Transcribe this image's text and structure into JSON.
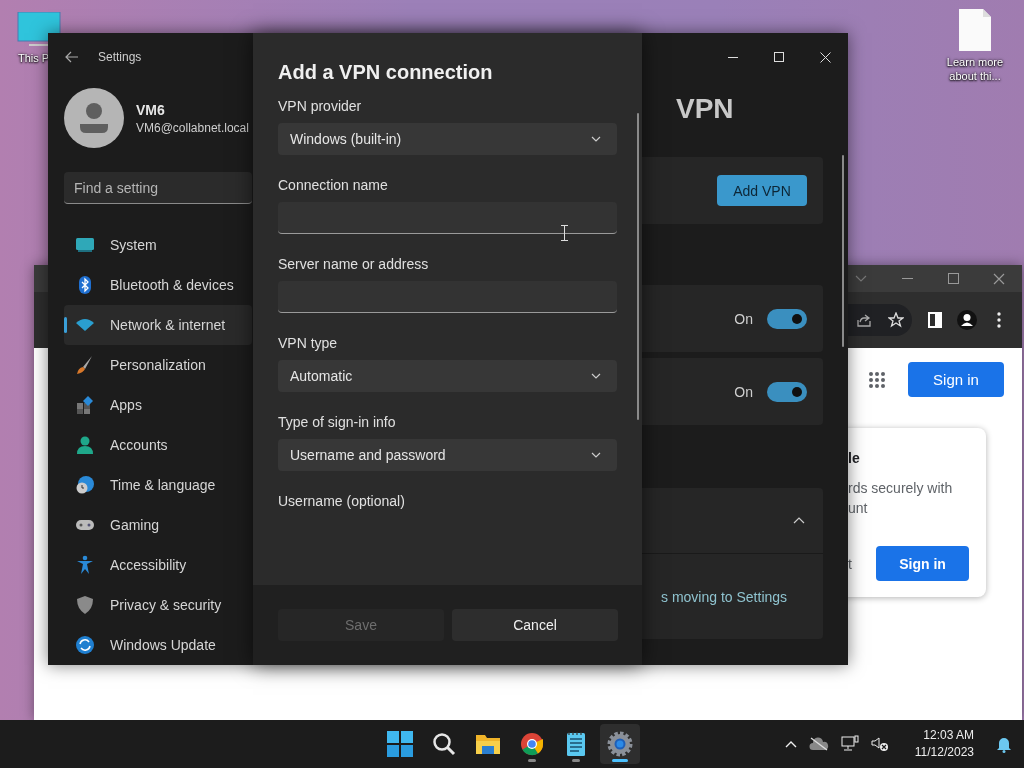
{
  "desktop_icons": [
    {
      "kind": "monitor",
      "label": "This P"
    },
    {
      "kind": "document",
      "label": "Learn more about thi..."
    }
  ],
  "browser": {
    "buttons": [
      "Sign in"
    ],
    "card": {
      "heading": "le",
      "lines": [
        "rds securely with",
        "unt"
      ],
      "footer_text": "t",
      "button": "Sign in"
    }
  },
  "settings": {
    "title": "Settings",
    "user": {
      "name": "VM6",
      "email": "VM6@collabnet.local"
    },
    "search": {
      "placeholder": "Find a setting"
    },
    "nav": [
      {
        "kind": "system",
        "label": "System",
        "selected": false
      },
      {
        "kind": "bluetooth",
        "label": "Bluetooth & devices",
        "selected": false
      },
      {
        "kind": "network",
        "label": "Network & internet",
        "selected": true
      },
      {
        "kind": "brush",
        "label": "Personalization",
        "selected": false
      },
      {
        "kind": "apps",
        "label": "Apps",
        "selected": false
      },
      {
        "kind": "accounts",
        "label": "Accounts",
        "selected": false
      },
      {
        "kind": "time",
        "label": "Time & language",
        "selected": false
      },
      {
        "kind": "gaming",
        "label": "Gaming",
        "selected": false
      },
      {
        "kind": "accessibility",
        "label": "Accessibility",
        "selected": false
      },
      {
        "kind": "privacy",
        "label": "Privacy & security",
        "selected": false
      },
      {
        "kind": "update",
        "label": "Windows Update",
        "selected": false
      }
    ],
    "page": {
      "title": "VPN",
      "add_button": "Add VPN",
      "toggles": [
        {
          "label": "On",
          "on": true
        },
        {
          "label": "On",
          "on": true
        }
      ],
      "expander": {
        "expanded": true,
        "link": "s moving to Settings"
      }
    }
  },
  "dialog": {
    "title": "Add a VPN connection",
    "fields": [
      {
        "kind": "dropdown",
        "label": "VPN provider",
        "value": "Windows (built-in)"
      },
      {
        "kind": "text",
        "label": "Connection name"
      },
      {
        "kind": "text",
        "label": "Server name or address"
      },
      {
        "kind": "dropdown",
        "label": "VPN type",
        "value": "Automatic"
      },
      {
        "kind": "dropdown",
        "label": "Type of sign-in info",
        "value": "Username and password"
      },
      {
        "kind": "label",
        "label": "Username (optional)"
      }
    ],
    "buttons": [
      {
        "label": "Save",
        "disabled": true
      },
      {
        "label": "Cancel",
        "disabled": false
      }
    ]
  },
  "taskbar": {
    "apps": [
      {
        "kind": "start",
        "running": false,
        "selected": false
      },
      {
        "kind": "search",
        "running": false,
        "selected": false
      },
      {
        "kind": "files",
        "running": false,
        "selected": false
      },
      {
        "kind": "browser",
        "running": true,
        "selected": false
      },
      {
        "kind": "notepad",
        "running": true,
        "selected": false
      },
      {
        "kind": "settings",
        "running": true,
        "selected": true
      }
    ],
    "time": "12:03 AM",
    "date": "11/12/2023"
  }
}
